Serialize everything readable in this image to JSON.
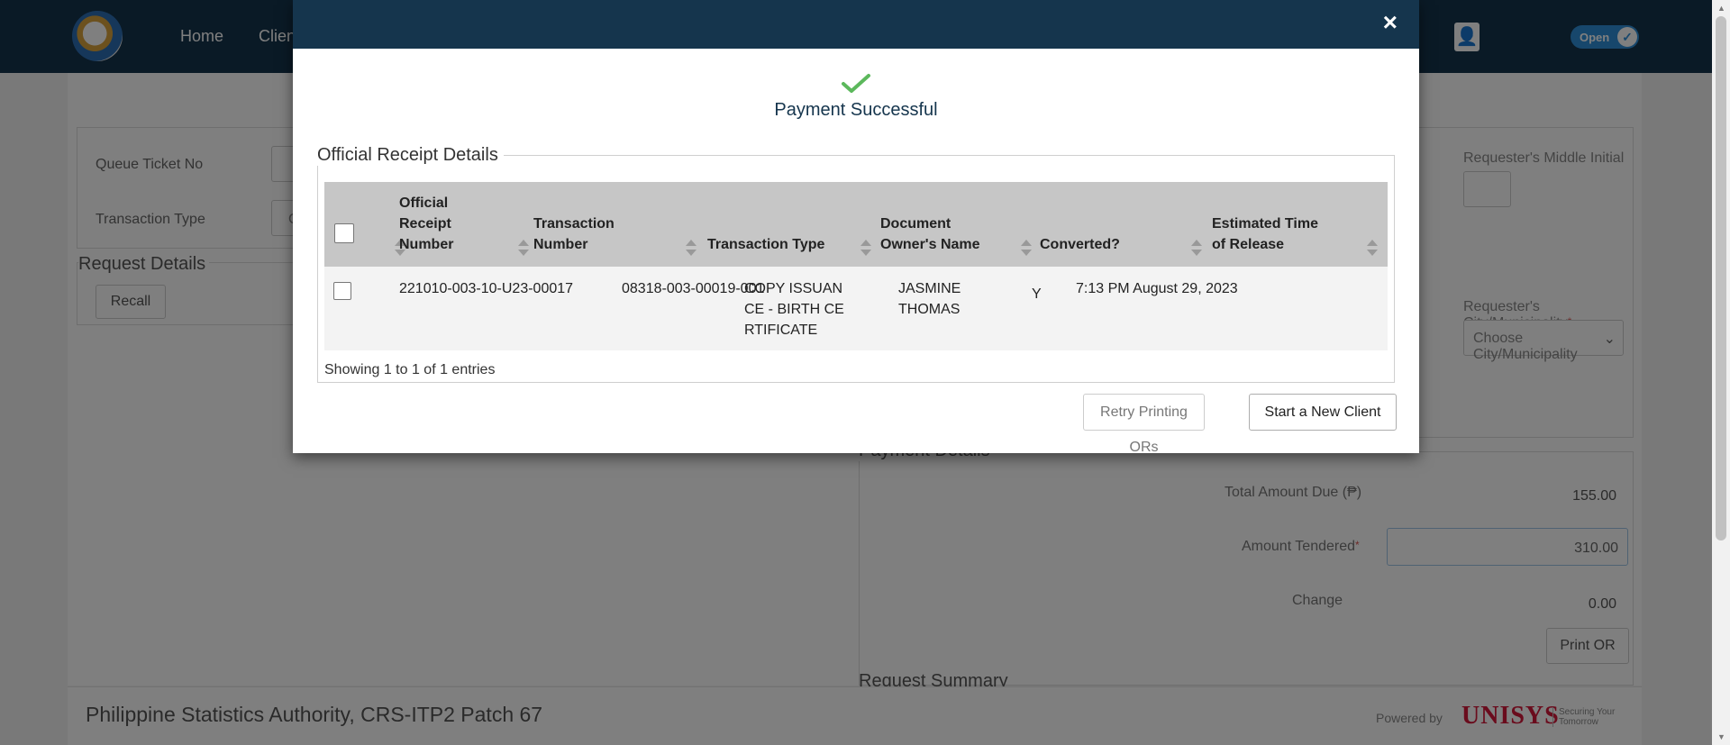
{
  "navbar": {
    "links": [
      "Home",
      "Clients"
    ],
    "status_toggle_label": "Open",
    "user_icon": "user-icon",
    "check_icon": "check-icon"
  },
  "background": {
    "queue_ticket_label": "Queue Ticket No",
    "transaction_type_label": "Transaction Type",
    "transaction_type_value": "C",
    "request_details_title": "Request Details",
    "recall_button": "Recall",
    "middle_initial_label": "Requester's Middle Initial",
    "city_label": "Requester's City/Municipality",
    "city_placeholder": "Choose City/Municipality",
    "payment_details_title": "Payment Details",
    "total_amount_label": "Total Amount Due (₱)",
    "total_amount_value": "155.00",
    "amount_tendered_label": "Amount Tendered",
    "amount_tendered_value": "310.00",
    "change_label": "Change",
    "change_value": "0.00",
    "print_or_button": "Print OR",
    "request_summary_title": "Request Summary"
  },
  "footer": {
    "text": "Philippine Statistics Authority, CRS-ITP2 Patch 67",
    "powered_by": "Powered by",
    "brand": "UNISYS",
    "tagline_line1": "Securing Your",
    "tagline_line2": "Tomorrow"
  },
  "modal": {
    "success_text": "Payment Successful",
    "legend": "Official Receipt Details",
    "columns": [
      "Official Receipt Number",
      "Transaction Number",
      "Transaction Type",
      "Document Owner's Name",
      "Converted?",
      "Estimated Time of Release"
    ],
    "rows": [
      {
        "or_number": "221010-003-10-U23-00017",
        "transaction_number": "08318-003-00019-001",
        "transaction_type": "COPY ISSUANCE - BIRTH CERTIFICATE",
        "owner_name": "JASMINE THOMAS",
        "converted": "Y",
        "release_time": "7:13 PM August 29, 2023"
      }
    ],
    "showing_text": "Showing 1 to 1 of 1 entries",
    "retry_button": "Retry Printing ORs",
    "new_client_button": "Start a New Client",
    "close_symbol": "×",
    "colors": {
      "header": "#15354d",
      "success_check": "#5cb85c",
      "table_header": "#c6c6c6"
    }
  }
}
